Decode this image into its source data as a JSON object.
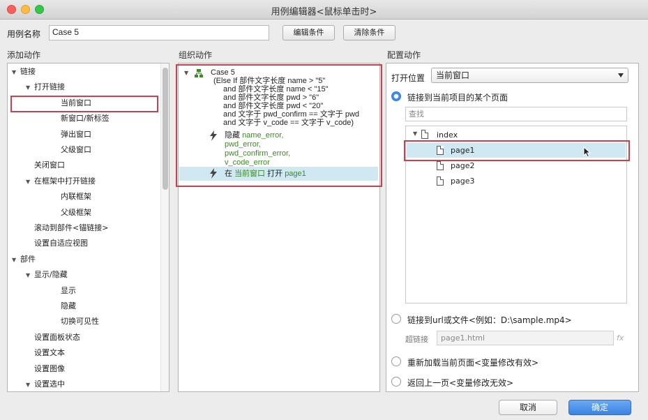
{
  "window": {
    "title": "用例编辑器<鼠标单击时>"
  },
  "case_name": {
    "label": "用例名称",
    "value": "Case 5"
  },
  "toolbar": {
    "edit_condition": "编辑条件",
    "clear_condition": "清除条件"
  },
  "sections": {
    "add_action": "添加动作",
    "organize_action": "组织动作",
    "configure_action": "配置动作"
  },
  "actions_tree": [
    {
      "label": "链接",
      "level": 0,
      "arrow": "▼"
    },
    {
      "label": "打开链接",
      "level": 1,
      "arrow": "▼"
    },
    {
      "label": "当前窗口",
      "level": 2,
      "arrow": ""
    },
    {
      "label": "新窗口/新标签",
      "level": 2,
      "arrow": ""
    },
    {
      "label": "弹出窗口",
      "level": 2,
      "arrow": ""
    },
    {
      "label": "父级窗口",
      "level": 2,
      "arrow": ""
    },
    {
      "label": "关闭窗口",
      "level": 1,
      "arrow": ""
    },
    {
      "label": "在框架中打开链接",
      "level": 1,
      "arrow": "▼"
    },
    {
      "label": "内联框架",
      "level": 2,
      "arrow": ""
    },
    {
      "label": "父级框架",
      "level": 2,
      "arrow": ""
    },
    {
      "label": "滚动到部件<锚链接>",
      "level": 1,
      "arrow": ""
    },
    {
      "label": "设置自适应视图",
      "level": 1,
      "arrow": ""
    },
    {
      "label": "部件",
      "level": 0,
      "arrow": "▼"
    },
    {
      "label": "显示/隐藏",
      "level": 1,
      "arrow": "▼"
    },
    {
      "label": "显示",
      "level": 2,
      "arrow": ""
    },
    {
      "label": "隐藏",
      "level": 2,
      "arrow": ""
    },
    {
      "label": "切换可见性",
      "level": 2,
      "arrow": ""
    },
    {
      "label": "设置面板状态",
      "level": 1,
      "arrow": ""
    },
    {
      "label": "设置文本",
      "level": 1,
      "arrow": ""
    },
    {
      "label": "设置图像",
      "level": 1,
      "arrow": ""
    },
    {
      "label": "设置选中",
      "level": 1,
      "arrow": "▼"
    }
  ],
  "case_block": {
    "name": "Case 5",
    "conditions": [
      "(Else If 部件文字长度 name > \"5\"",
      "and 部件文字长度 name < \"15\"",
      "and 部件文字长度 pwd > \"6\"",
      "and 部件文字长度 pwd < \"20\"",
      "and 文字于 pwd_confirm == 文字于 pwd",
      "and 文字于 v_code == 文字于 v_code)"
    ],
    "action1": {
      "verb": "隐藏",
      "targets": [
        "name_error,",
        "pwd_error,",
        "pwd_confirm_error,",
        "v_code_error"
      ]
    },
    "action2": {
      "prefix": "在",
      "window": "当前窗口",
      "open": "打开",
      "target": "page1"
    }
  },
  "config": {
    "open_position_label": "打开位置",
    "open_position_value": "当前窗口",
    "radio_link_page": "链接到当前项目的某个页面",
    "search_placeholder": "查找",
    "pages": {
      "root": "index",
      "children": [
        "page1",
        "page2",
        "page3"
      ]
    },
    "radio_link_url": "链接到url或文件<例如：D:\\sample.mp4>",
    "hyperlink_label": "超链接",
    "hyperlink_value": "page1.html",
    "fx": "fx",
    "radio_reload": "重新加载当前页面<变量修改有效>",
    "radio_back": "返回上一页<变量修改无效>"
  },
  "footer": {
    "cancel": "取消",
    "ok": "确定"
  }
}
